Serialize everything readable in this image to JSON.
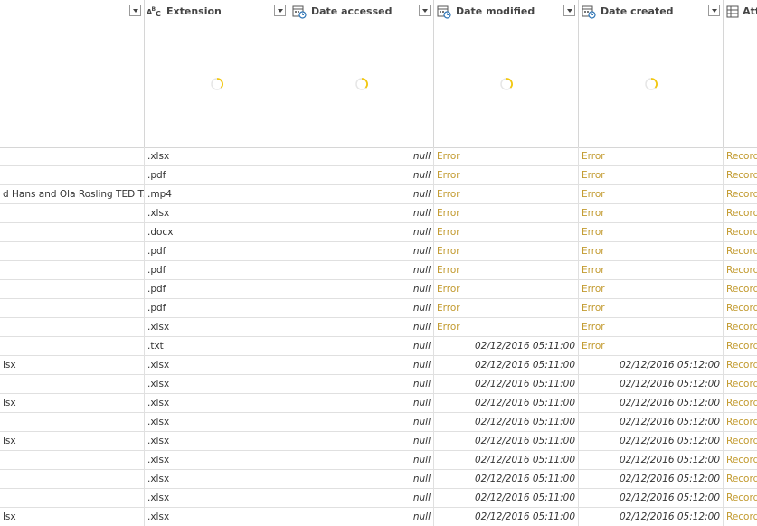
{
  "columns": [
    {
      "title": "",
      "icon": "none"
    },
    {
      "title": "Extension",
      "icon": "text-type-icon",
      "icon_glyph": "ABC"
    },
    {
      "title": "Date accessed",
      "icon": "datetime-type-icon"
    },
    {
      "title": "Date modified",
      "icon": "datetime-type-icon"
    },
    {
      "title": "Date created",
      "icon": "datetime-type-icon"
    },
    {
      "title": "Att",
      "icon": "table-type-icon"
    }
  ],
  "rows": [
    {
      "name": "",
      "ext": ".xlsx",
      "accessed": "null",
      "modified": "Error",
      "created": "Error",
      "attr": "Record"
    },
    {
      "name": "",
      "ext": ".pdf",
      "accessed": "null",
      "modified": "Error",
      "created": "Error",
      "attr": "Record"
    },
    {
      "name": "d  Hans and Ola Rosling  TED T...",
      "ext": ".mp4",
      "accessed": "null",
      "modified": "Error",
      "created": "Error",
      "attr": "Record"
    },
    {
      "name": "",
      "ext": ".xlsx",
      "accessed": "null",
      "modified": "Error",
      "created": "Error",
      "attr": "Record"
    },
    {
      "name": "",
      "ext": ".docx",
      "accessed": "null",
      "modified": "Error",
      "created": "Error",
      "attr": "Record"
    },
    {
      "name": "",
      "ext": ".pdf",
      "accessed": "null",
      "modified": "Error",
      "created": "Error",
      "attr": "Record"
    },
    {
      "name": "",
      "ext": ".pdf",
      "accessed": "null",
      "modified": "Error",
      "created": "Error",
      "attr": "Record"
    },
    {
      "name": "",
      "ext": ".pdf",
      "accessed": "null",
      "modified": "Error",
      "created": "Error",
      "attr": "Record"
    },
    {
      "name": "",
      "ext": ".pdf",
      "accessed": "null",
      "modified": "Error",
      "created": "Error",
      "attr": "Record"
    },
    {
      "name": "",
      "ext": ".xlsx",
      "accessed": "null",
      "modified": "Error",
      "created": "Error",
      "attr": "Record"
    },
    {
      "name": "",
      "ext": ".txt",
      "accessed": "null",
      "modified": "02/12/2016 05:11:00",
      "created": "Error",
      "attr": "Record"
    },
    {
      "name": "lsx",
      "ext": ".xlsx",
      "accessed": "null",
      "modified": "02/12/2016 05:11:00",
      "created": "02/12/2016 05:12:00",
      "attr": "Record"
    },
    {
      "name": "",
      "ext": ".xlsx",
      "accessed": "null",
      "modified": "02/12/2016 05:11:00",
      "created": "02/12/2016 05:12:00",
      "attr": "Record"
    },
    {
      "name": "lsx",
      "ext": ".xlsx",
      "accessed": "null",
      "modified": "02/12/2016 05:11:00",
      "created": "02/12/2016 05:12:00",
      "attr": "Record"
    },
    {
      "name": "",
      "ext": ".xlsx",
      "accessed": "null",
      "modified": "02/12/2016 05:11:00",
      "created": "02/12/2016 05:12:00",
      "attr": "Record"
    },
    {
      "name": "lsx",
      "ext": ".xlsx",
      "accessed": "null",
      "modified": "02/12/2016 05:11:00",
      "created": "02/12/2016 05:12:00",
      "attr": "Record"
    },
    {
      "name": "",
      "ext": ".xlsx",
      "accessed": "null",
      "modified": "02/12/2016 05:11:00",
      "created": "02/12/2016 05:12:00",
      "attr": "Record"
    },
    {
      "name": "",
      "ext": ".xlsx",
      "accessed": "null",
      "modified": "02/12/2016 05:11:00",
      "created": "02/12/2016 05:12:00",
      "attr": "Record"
    },
    {
      "name": "",
      "ext": ".xlsx",
      "accessed": "null",
      "modified": "02/12/2016 05:11:00",
      "created": "02/12/2016 05:12:00",
      "attr": "Record"
    },
    {
      "name": "lsx",
      "ext": ".xlsx",
      "accessed": "null",
      "modified": "02/12/2016 05:11:00",
      "created": "02/12/2016 05:12:00",
      "attr": "Record"
    }
  ],
  "colors": {
    "error": "#c29a2e",
    "record": "#c29a2e",
    "spinner": "#f2c811",
    "border": "#d6d6d6"
  }
}
